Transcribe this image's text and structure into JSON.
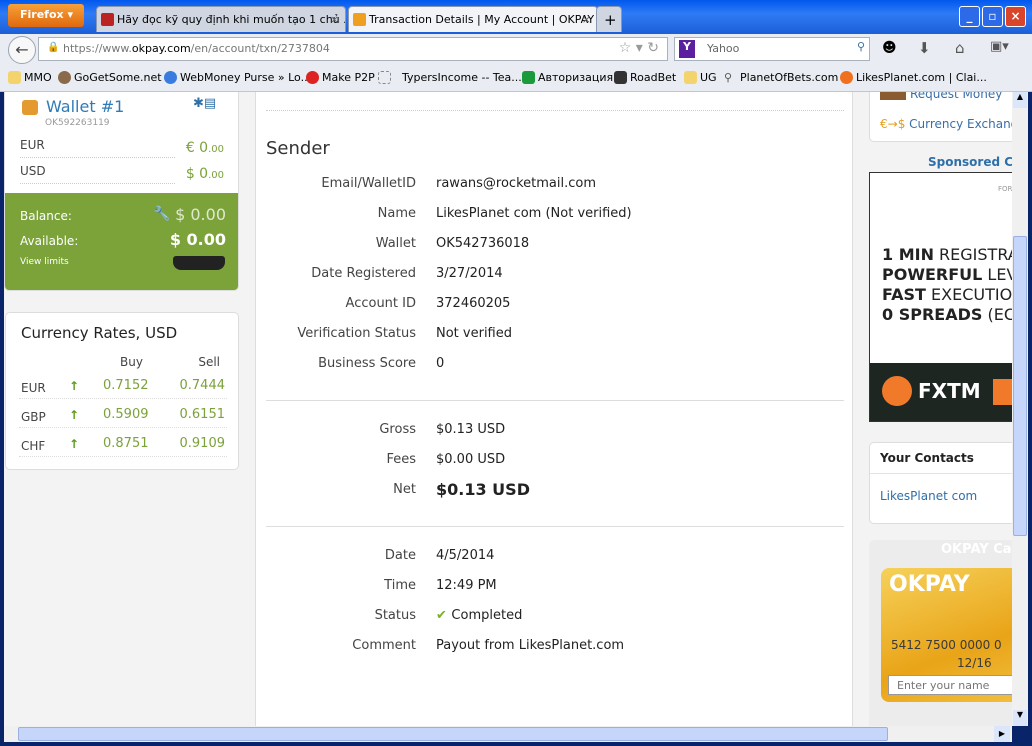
{
  "browser": {
    "menu_label": "Firefox",
    "tabs": [
      {
        "title": "Hãy đọc kỹ quy định khi muốn tạo 1 chủ ...",
        "active": false
      },
      {
        "title": "Transaction Details | My Account | OKPAY",
        "active": true
      }
    ],
    "new_tab": "+",
    "url_prefix": "https://www.",
    "url_domain": "okpay.com",
    "url_path": "/en/account/txn/2737804",
    "search_engine": "Yahoo",
    "bookmarks": [
      "MMO",
      "GoGetSome.net",
      "WebMoney Purse » Lo...",
      "Make P2P",
      "TypersIncome -- Tea...",
      "Авторизация",
      "RoadBet",
      "UG",
      "PlanetOfBets.com",
      "LikesPlanet.com | Clai..."
    ]
  },
  "wallet": {
    "title": "Wallet #1",
    "id": "OK592263119",
    "rows": [
      {
        "cur": "EUR",
        "sym": "€ 0",
        "dec": ".00"
      },
      {
        "cur": "USD",
        "sym": "$ 0",
        "dec": ".00"
      }
    ],
    "balance_label": "Balance:",
    "balance": "$ 0.00",
    "available_label": "Available:",
    "available": "$ 0.00",
    "view_limits": "View limits"
  },
  "rates": {
    "title": "Currency Rates, USD",
    "buy": "Buy",
    "sell": "Sell",
    "rows": [
      {
        "cur": "EUR",
        "buy": "0.7152",
        "sell": "0.7444"
      },
      {
        "cur": "GBP",
        "buy": "0.5909",
        "sell": "0.6151"
      },
      {
        "cur": "CHF",
        "buy": "0.8751",
        "sell": "0.9109"
      }
    ]
  },
  "sender": {
    "heading": "Sender",
    "fields": [
      {
        "label": "Email/WalletID",
        "value": "rawans@rocketmail.com"
      },
      {
        "label": "Name",
        "value": "LikesPlanet com (Not verified)"
      },
      {
        "label": "Wallet",
        "value": "OK542736018"
      },
      {
        "label": "Date Registered",
        "value": "3/27/2014"
      },
      {
        "label": "Account ID",
        "value": "372460205"
      },
      {
        "label": "Verification Status",
        "value": "Not verified"
      },
      {
        "label": "Business Score",
        "value": "0"
      }
    ]
  },
  "amounts": [
    {
      "label": "Gross",
      "value": "$0.13 USD"
    },
    {
      "label": "Fees",
      "value": "$0.00 USD"
    },
    {
      "label": "Net",
      "value": "$0.13 USD"
    }
  ],
  "details": [
    {
      "label": "Date",
      "value": "4/5/2014"
    },
    {
      "label": "Time",
      "value": "12:49 PM"
    },
    {
      "label": "Status",
      "value": "Completed"
    },
    {
      "label": "Comment",
      "value": "Payout from LikesPlanet.com"
    }
  ],
  "right": {
    "request_money": "Request Money",
    "currency_exchange": "Currency Exchange",
    "sponsored": "Sponsored Co",
    "ad_lines": [
      [
        "1 MIN",
        " REGISTRA"
      ],
      [
        "POWERFUL",
        " LEV"
      ],
      [
        "FAST",
        " EXECUTIO"
      ],
      [
        "0 SPREADS",
        " (EC"
      ]
    ],
    "ad_top": "FOR",
    "ad_brand": "FXTM",
    "contacts_title": "Your Contacts",
    "contact": "LikesPlanet com",
    "card_title": "OKPAY Ca",
    "card_logo": "OKPAY",
    "card_number": "5412 7500 0000 0",
    "card_expiry": "12/16",
    "card_name_placeholder": "Enter your name"
  }
}
